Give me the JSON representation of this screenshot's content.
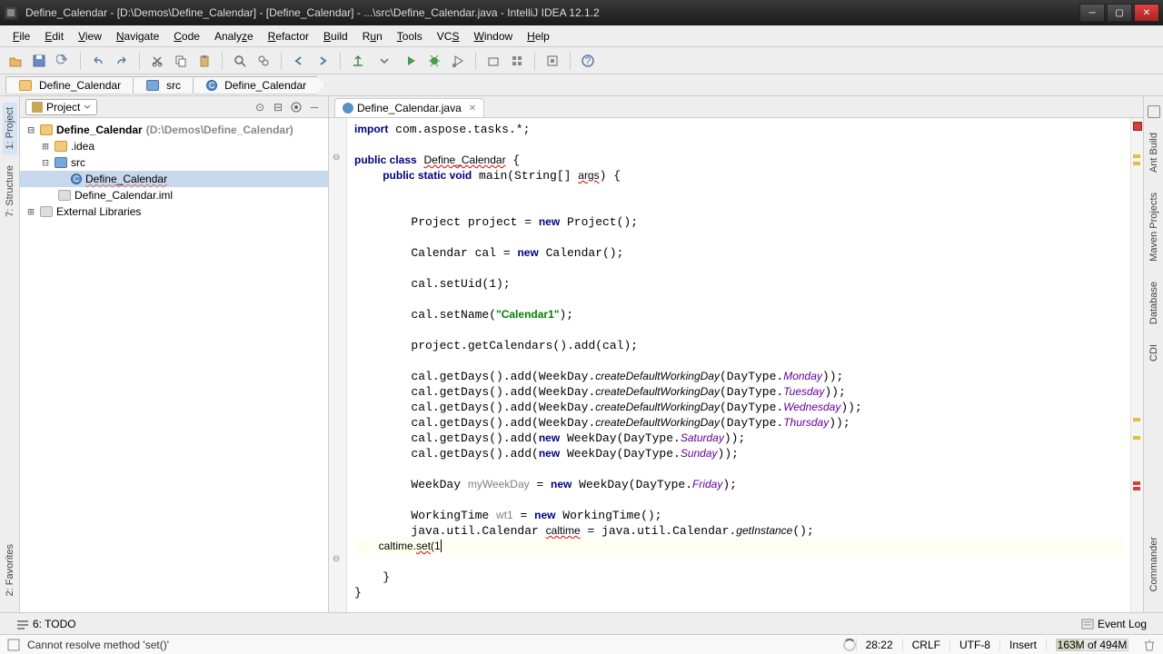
{
  "title": "Define_Calendar - [D:\\Demos\\Define_Calendar] - [Define_Calendar] - ...\\src\\Define_Calendar.java - IntelliJ IDEA 12.1.2",
  "menu": [
    "File",
    "Edit",
    "View",
    "Navigate",
    "Code",
    "Analyze",
    "Refactor",
    "Build",
    "Run",
    "Tools",
    "VCS",
    "Window",
    "Help"
  ],
  "breadcrumb": [
    {
      "label": "Define_Calendar",
      "icon": "folder"
    },
    {
      "label": "src",
      "icon": "folder-blue"
    },
    {
      "label": "Define_Calendar",
      "icon": "class"
    }
  ],
  "project_panel": {
    "combo": "Project",
    "root_label": "Define_Calendar",
    "root_path": "(D:\\Demos\\Define_Calendar)",
    "idea_label": ".idea",
    "src_label": "src",
    "class_label": "Define_Calendar",
    "iml_label": "Define_Calendar.iml",
    "ext_lib_label": "External Libraries"
  },
  "left_tabs": {
    "project": "1: Project",
    "structure": "7: Structure",
    "favorites": "2: Favorites"
  },
  "right_tabs": {
    "ant": "Ant Build",
    "maven": "Maven Projects",
    "db": "Database",
    "cdi": "CDI",
    "commander": "Commander"
  },
  "tab": {
    "label": "Define_Calendar.java"
  },
  "code": {
    "l1": "import com.aspose.tasks.*;",
    "l3a": "public class ",
    "l3b": "Define_Calendar",
    "l3c": " {",
    "l4a": "    public static void ",
    "l4b": "main",
    "l4c": "(String[] args) {",
    "l7": "        Project project = new Project();",
    "l9": "        Calendar cal = new Calendar();",
    "l11": "        cal.setUid(1);",
    "l13a": "        cal.setName(",
    "l13b": "\"Calendar1\"",
    "l13c": ");",
    "l15": "        project.getCalendars().add(cal);",
    "l17a": "        cal.getDays().add(WeekDay.",
    "l17b": "createDefaultWorkingDay",
    "l17c": "(DayType.",
    "l17d": "Monday",
    "l17e": "));",
    "l18a": "        cal.getDays().add(WeekDay.",
    "l18b": "createDefaultWorkingDay",
    "l18c": "(DayType.",
    "l18d": "Tuesday",
    "l18e": "));",
    "l19a": "        cal.getDays().add(WeekDay.",
    "l19b": "createDefaultWorkingDay",
    "l19c": "(DayType.",
    "l19d": "Wednesday",
    "l19e": "));",
    "l20a": "        cal.getDays().add(WeekDay.",
    "l20b": "createDefaultWorkingDay",
    "l20c": "(DayType.",
    "l20d": "Thursday",
    "l20e": "));",
    "l21a": "        cal.getDays().add(new WeekDay(DayType.",
    "l21b": "Saturday",
    "l21c": "));",
    "l22a": "        cal.getDays().add(new WeekDay(DayType.",
    "l22b": "Sunday",
    "l22c": "));",
    "l24a": "        WeekDay ",
    "l24b": "myWeekDay",
    "l24c": " = new WeekDay(DayType.",
    "l24d": "Friday",
    "l24e": ");",
    "l26a": "        WorkingTime ",
    "l26b": "wt1",
    "l26c": " = new WorkingTime();",
    "l27a": "        java.util.Calendar ",
    "l27b": "caltime",
    "l27c": " = java.util.Calendar.",
    "l27d": "getInstance",
    "l27e": "();",
    "l28a": "        caltime.",
    "l28b": "set",
    "l28c": "(1",
    "l30": "    }",
    "l31": "}"
  },
  "dock": {
    "todo": "6: TODO",
    "eventlog": "Event Log"
  },
  "status": {
    "msg": "Cannot resolve method 'set()'",
    "pos": "28:22",
    "crlf": "CRLF",
    "enc": "UTF-8",
    "ins": "Insert",
    "mem": "163M of 494M"
  }
}
